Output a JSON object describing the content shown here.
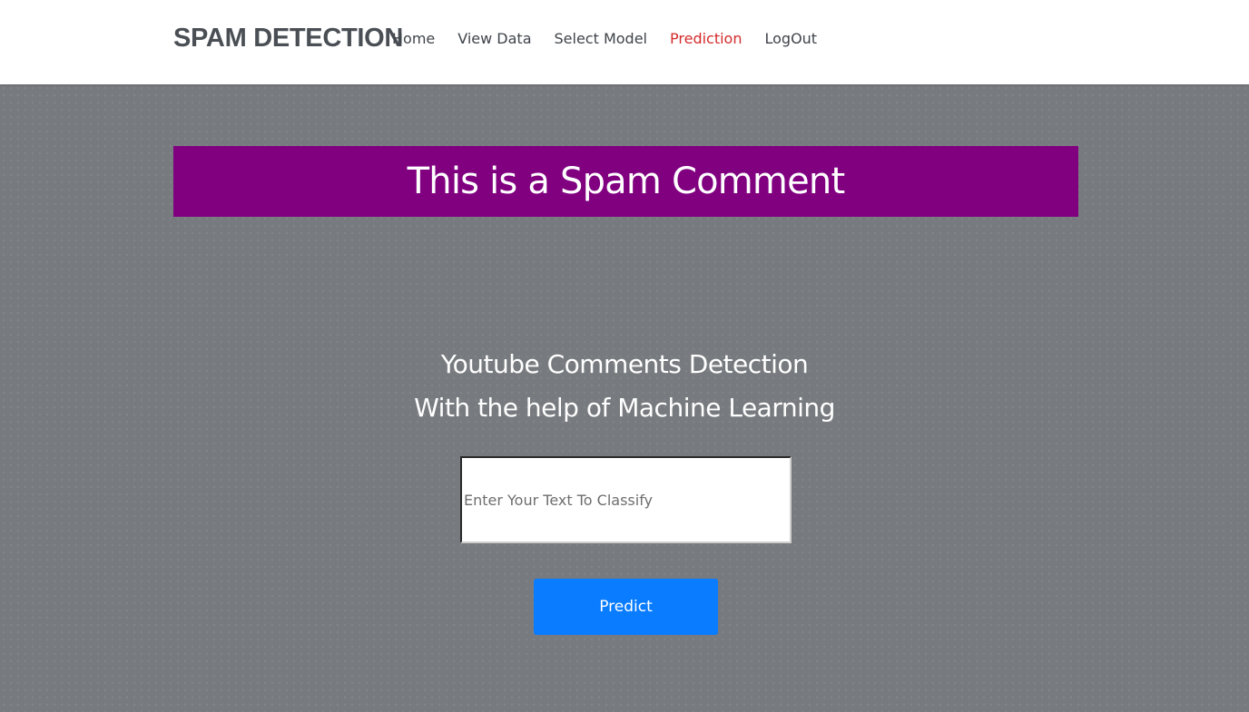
{
  "nav": {
    "brand": "SPAM DETECTION",
    "links": [
      {
        "label": "Home",
        "active": false
      },
      {
        "label": "View Data",
        "active": false
      },
      {
        "label": "Select Model",
        "active": false
      },
      {
        "label": "Prediction",
        "active": true
      },
      {
        "label": "LogOut",
        "active": false
      }
    ]
  },
  "result": {
    "text": "This is a Spam Comment",
    "background_color": "#800080"
  },
  "form": {
    "heading_line1": "Youtube Comments Detection",
    "heading_line2": "With the help of Machine Learning",
    "input_placeholder": "Enter Your Text To Classify",
    "input_value": "",
    "button_label": "Predict",
    "button_color": "#0a7cff"
  },
  "colors": {
    "active_nav": "#d42b2b",
    "page_background": "#777a7e"
  }
}
